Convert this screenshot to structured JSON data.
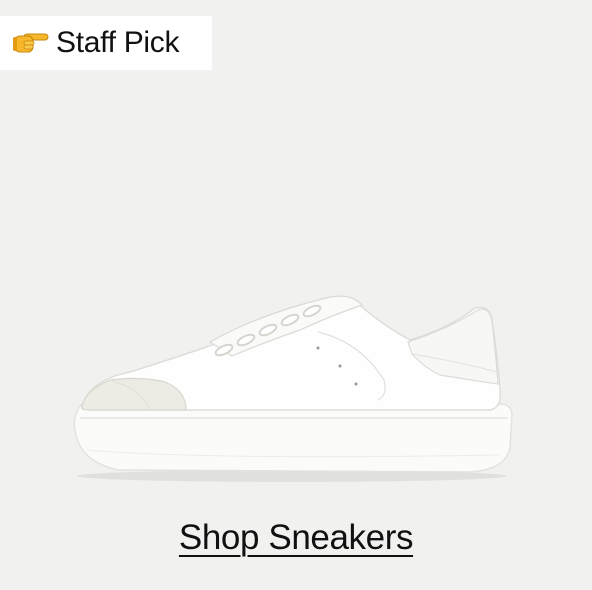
{
  "badge": {
    "icon": "pointing-hand-icon",
    "label": "Staff Pick"
  },
  "product": {
    "image": "white-platform-sneaker-image"
  },
  "cta": {
    "label": "Shop Sneakers"
  },
  "colors": {
    "background": "#f1f1ef",
    "badge_background": "#ffffff",
    "text": "#111111"
  }
}
